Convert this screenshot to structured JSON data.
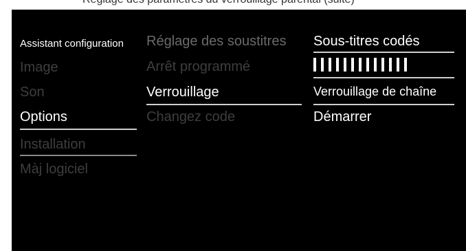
{
  "header": {
    "caption": "Réglage des paramètres du verrouillage parental (suite)"
  },
  "menu": {
    "main": [
      {
        "label": "Assistant configuration"
      },
      {
        "label": "Image"
      },
      {
        "label": "Son"
      },
      {
        "label": "Options"
      },
      {
        "label": "Installation"
      },
      {
        "label": "Màj logiciel"
      }
    ],
    "sub": [
      {
        "label": "Réglage des soustitres"
      },
      {
        "label": "Arrêt programmé"
      },
      {
        "label": "Verrouillage"
      },
      {
        "label": "Changez code"
      }
    ],
    "options": [
      {
        "label": "Sous-titres codés"
      },
      {
        "label": "Verrouillage de chaîne"
      },
      {
        "label": "Démarrer"
      }
    ],
    "selected_main": "Options",
    "selected_sub": "Verrouillage",
    "bar_count": 13
  },
  "colors": {
    "background": "#000000",
    "active": "#ffffff",
    "inactive": "#3e3e3e",
    "underline": "#cfcfcf"
  }
}
